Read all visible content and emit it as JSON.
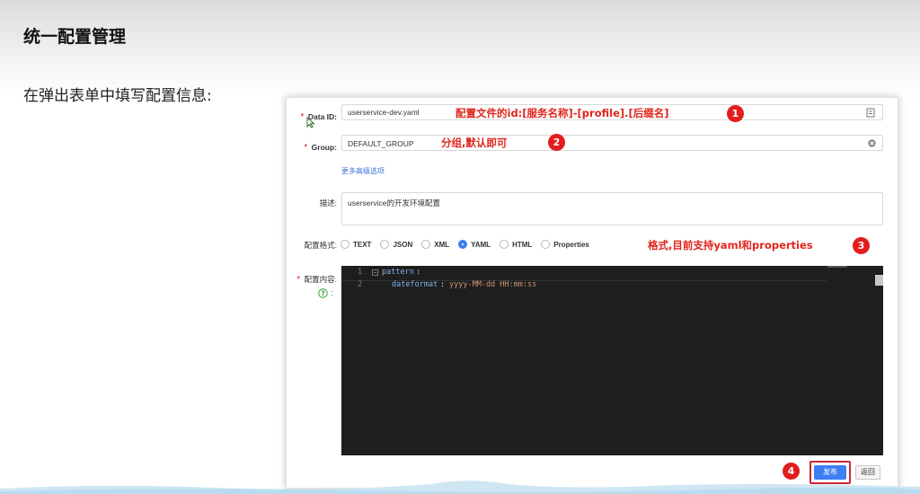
{
  "slide": {
    "title": "统一配置管理",
    "subtitle": "在弹出表单中填写配置信息:"
  },
  "form": {
    "required_mark": "*",
    "data_id": {
      "label": "Data ID:",
      "value": "userservice-dev.yaml",
      "annotation": "配置文件的id:[服务名称]-[profile].[后缀名]",
      "badge": "1"
    },
    "group": {
      "label": "Group:",
      "value": "DEFAULT_GROUP",
      "annotation": "分组,默认即可",
      "badge": "2"
    },
    "more_options_link": "更多高级选项",
    "description": {
      "label": "描述:",
      "value": "userservice的开发环境配置"
    },
    "format": {
      "label": "配置格式:",
      "options": [
        "TEXT",
        "JSON",
        "XML",
        "YAML",
        "HTML",
        "Properties"
      ],
      "selected": "YAML",
      "annotation": "格式,目前支持yaml和properties",
      "badge": "3"
    },
    "content": {
      "label": "配置内容:",
      "help_colon": ":",
      "lines": [
        {
          "num": "1",
          "key": "pattern",
          "colon": ":",
          "value": ""
        },
        {
          "num": "2",
          "key": "dateformat",
          "colon": ":",
          "value": "yyyy-MM-dd HH:mm:ss"
        }
      ]
    },
    "actions": {
      "publish_label": "发布",
      "back_label": "返回",
      "badge": "4"
    }
  },
  "colors": {
    "accent": "#3d7df5",
    "annotation_red": "#e0251b",
    "editor_bg": "#1e1e1e",
    "code_key": "#7cb3e6",
    "code_value": "#ce9178"
  },
  "icons": {
    "cursor": "mouse-pointer-icon",
    "clear": "clear-circle-icon",
    "copy": "copy-icon",
    "help": "question-icon",
    "fold": "fold-minus-icon"
  }
}
